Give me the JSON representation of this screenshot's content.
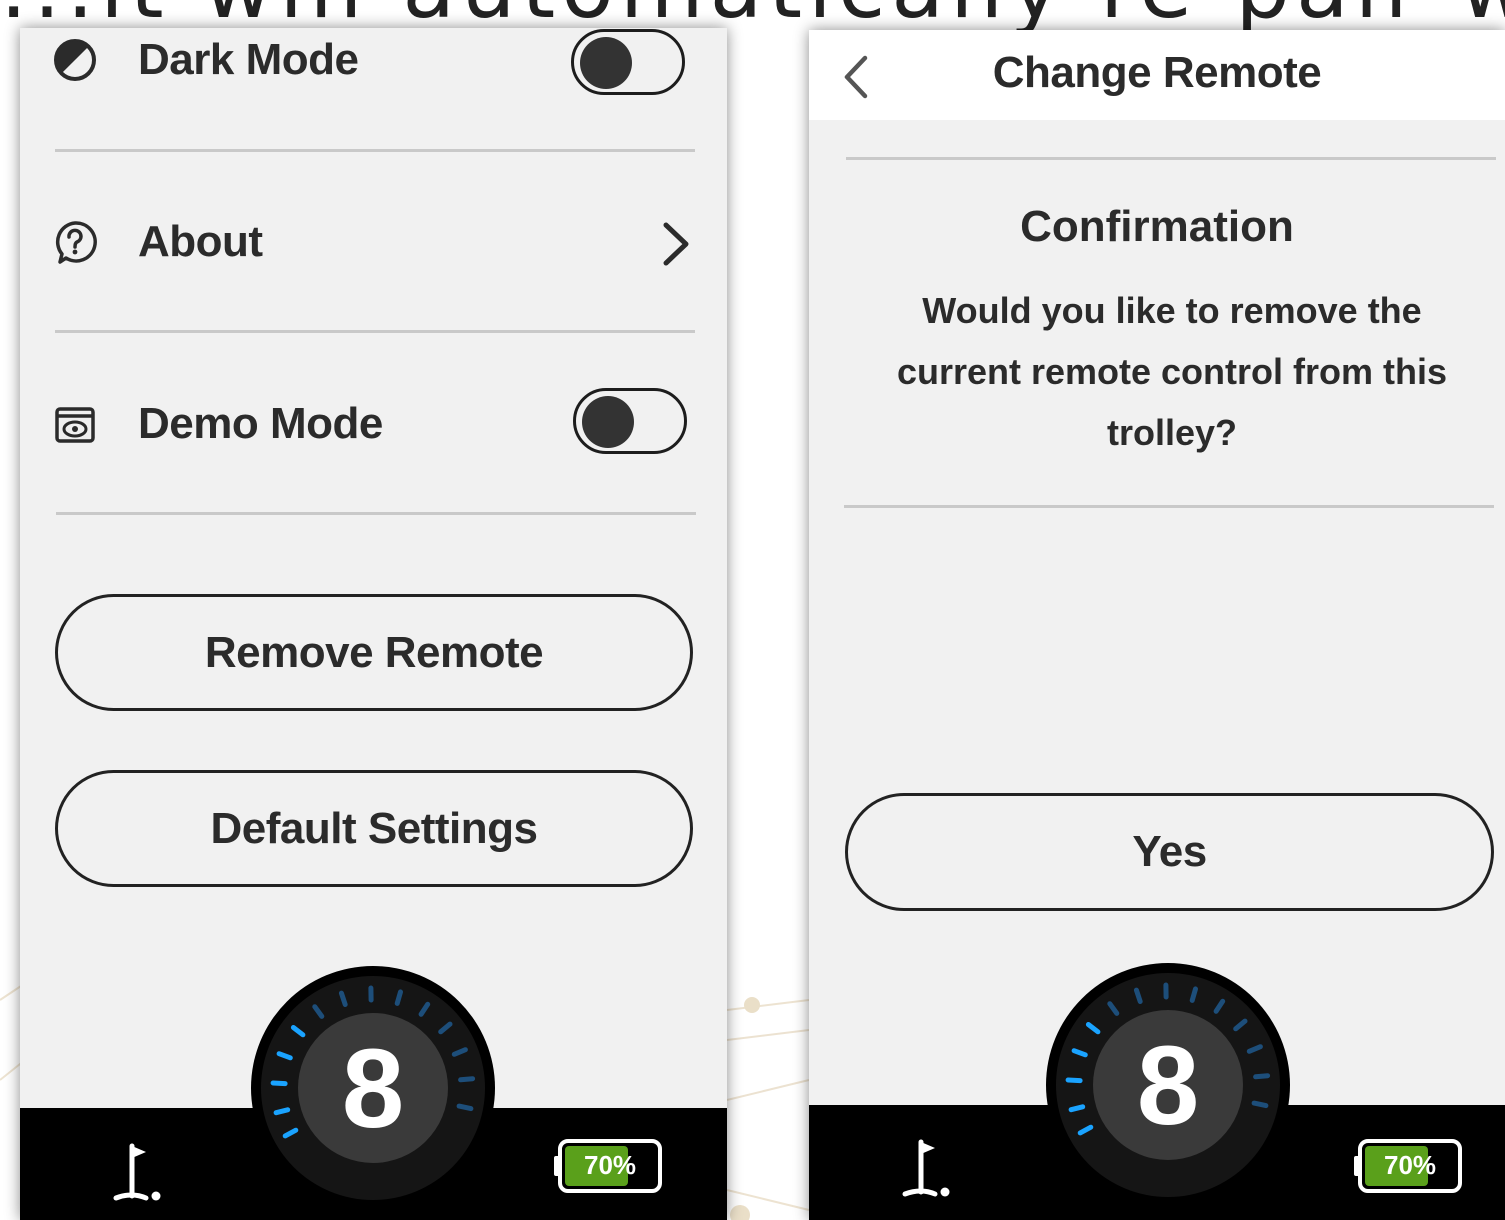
{
  "caption": "...it will automatically re-pair with the tre",
  "settings_screen": {
    "dark_mode": {
      "label": "Dark Mode",
      "icon": "half-circle-icon",
      "enabled": false
    },
    "about": {
      "label": "About",
      "icon": "help-circle-icon"
    },
    "demo_mode": {
      "label": "Demo Mode",
      "icon": "eye-box-icon",
      "enabled": false
    },
    "remove_remote_button": "Remove Remote",
    "default_settings_button": "Default Settings",
    "speed_dial": {
      "value": "8",
      "active_color": "#1aa3ff"
    },
    "battery": {
      "percent_label": "70%",
      "level": 0.7,
      "color": "#5aa01b"
    }
  },
  "change_remote_screen": {
    "header_title": "Change Remote",
    "confirmation_title": "Confirmation",
    "confirmation_message": "Would you like to remove the current remote control from this trolley?",
    "yes_button": "Yes",
    "speed_dial": {
      "value": "8",
      "active_color": "#1aa3ff"
    },
    "battery": {
      "percent_label": "70%",
      "level": 0.7,
      "color": "#5aa01b"
    }
  }
}
